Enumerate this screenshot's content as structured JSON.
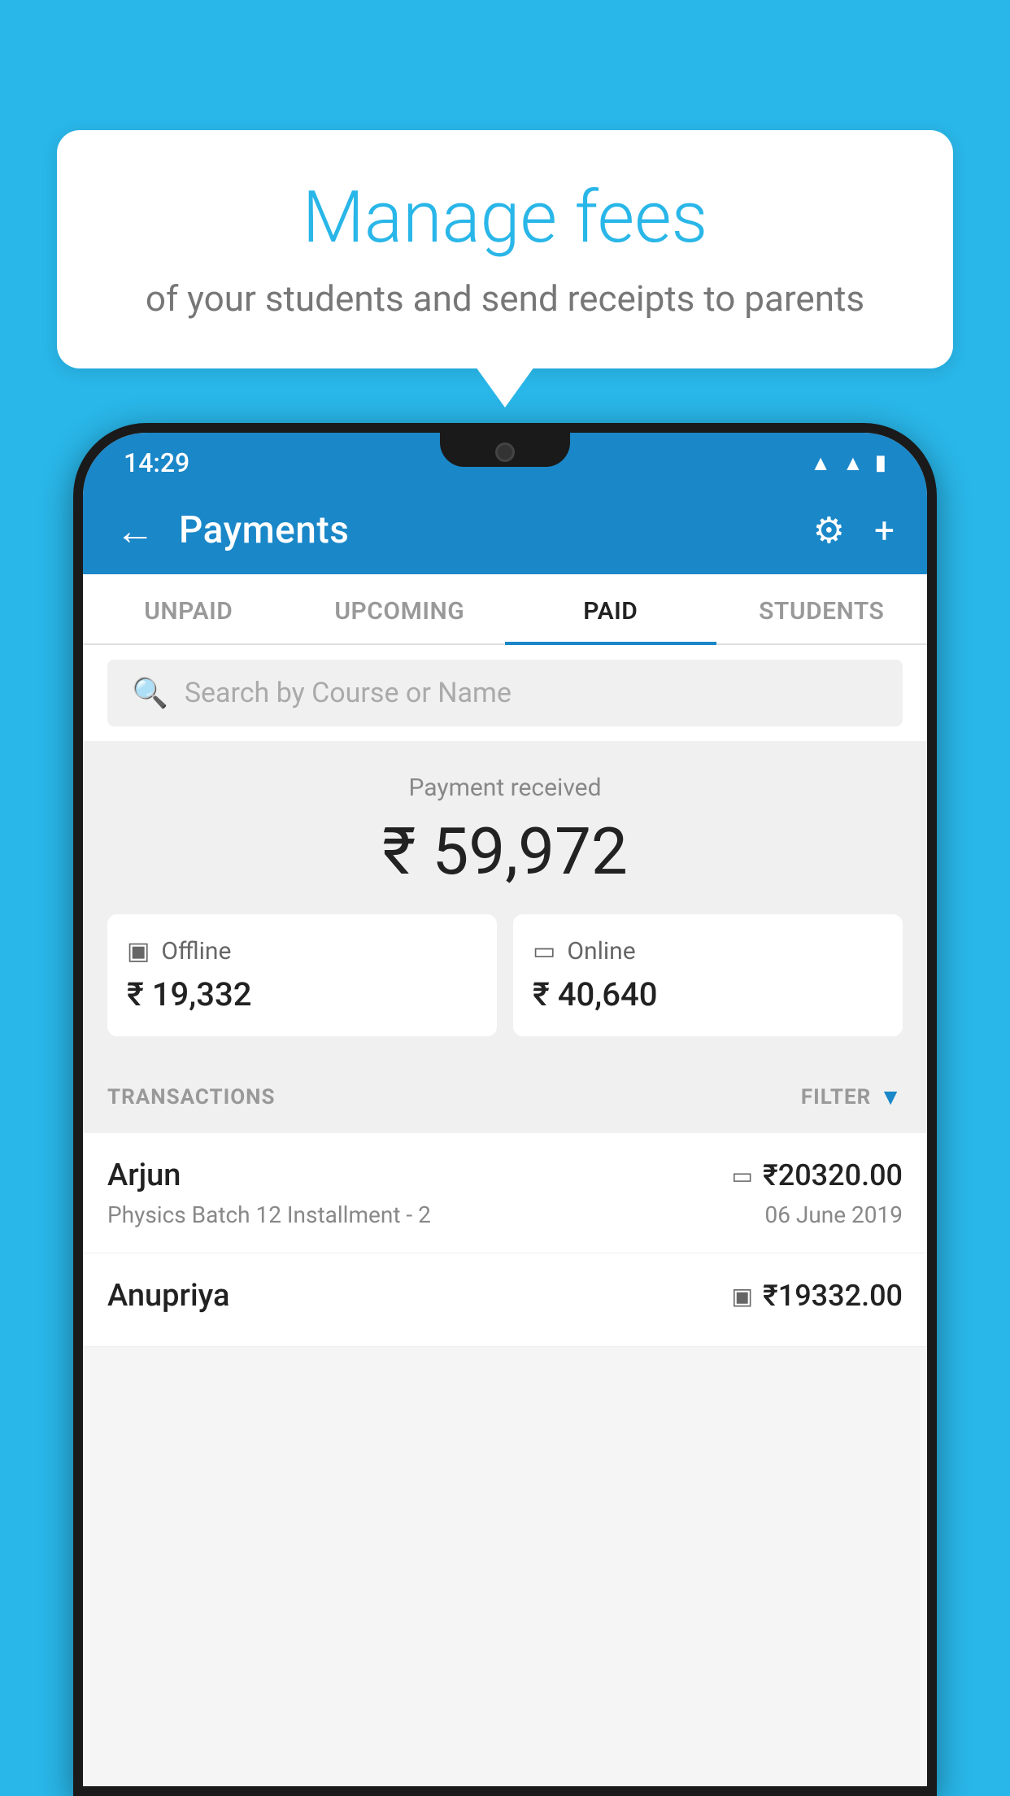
{
  "background_color": "#29b6e8",
  "bubble": {
    "title": "Manage fees",
    "subtitle": "of your students and send receipts to parents"
  },
  "status_bar": {
    "time": "14:29",
    "icons": [
      "wifi",
      "signal",
      "battery"
    ]
  },
  "header": {
    "title": "Payments",
    "back_label": "←",
    "settings_label": "⚙",
    "add_label": "+"
  },
  "tabs": [
    {
      "label": "UNPAID",
      "active": false
    },
    {
      "label": "UPCOMING",
      "active": false
    },
    {
      "label": "PAID",
      "active": true
    },
    {
      "label": "STUDENTS",
      "active": false
    }
  ],
  "search": {
    "placeholder": "Search by Course or Name"
  },
  "payment_summary": {
    "label": "Payment received",
    "total": "₹ 59,972",
    "offline_label": "Offline",
    "offline_amount": "₹ 19,332",
    "online_label": "Online",
    "online_amount": "₹ 40,640"
  },
  "transactions": {
    "section_label": "TRANSACTIONS",
    "filter_label": "FILTER",
    "items": [
      {
        "name": "Arjun",
        "description": "Physics Batch 12 Installment - 2",
        "amount": "₹20320.00",
        "date": "06 June 2019",
        "type": "online"
      },
      {
        "name": "Anupriya",
        "description": "",
        "amount": "₹19332.00",
        "date": "",
        "type": "offline"
      }
    ]
  }
}
